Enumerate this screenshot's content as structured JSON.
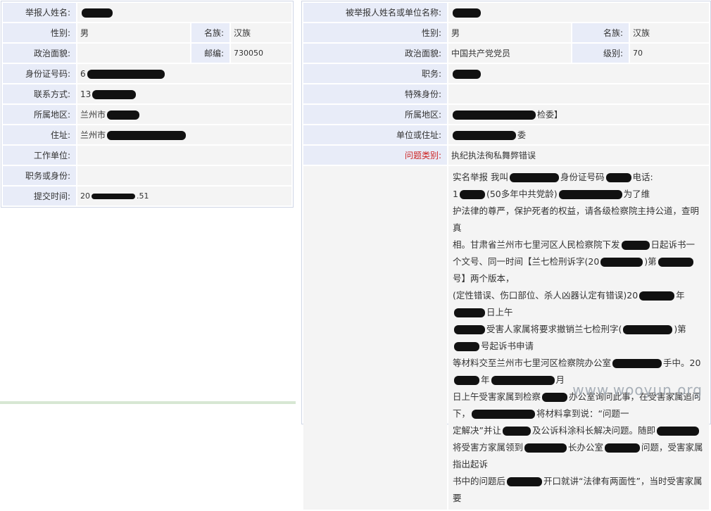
{
  "reporter": {
    "name_label": "举报人姓名:",
    "gender_label": "性别:",
    "gender": "男",
    "ethnicity_label": "名族:",
    "ethnicity": "汉族",
    "political_label": "政治面貌:",
    "postcode_label": "邮编:",
    "postcode": "730050",
    "idcard_label": "身份证号码:",
    "idcard_prefix": "6",
    "contact_label": "联系方式:",
    "contact_prefix": "13",
    "region_label": "所属地区:",
    "region_prefix": "兰州市",
    "address_label": "住址:",
    "address_prefix": "兰州市",
    "workunit_label": "工作单位:",
    "position_label": "职务或身份:",
    "submit_label": "提交时间:",
    "submit_prefix": "20",
    "submit_suffix": ".51"
  },
  "accused": {
    "name_label": "被举报人姓名或单位名称:",
    "gender_label": "性别:",
    "gender": "男",
    "ethnicity_label": "名族:",
    "ethnicity": "汉族",
    "political_label": "政治面貌:",
    "political": "中国共产党党员",
    "level_label": "级别:",
    "level": "70",
    "duty_label": "职务:",
    "special_label": "特殊身份:",
    "region_label": "所属地区:",
    "region_suffix": "检委】",
    "unit_label": "单位或住址:",
    "unit_suffix": "委",
    "category_label": "问题类别:",
    "category": "执纪执法徇私舞弊错误",
    "content_lines": [
      [
        "实名举报 我叫",
        "身份证号码",
        "电话:"
      ],
      [
        "1",
        "(50多年中共党龄)",
        "为了维"
      ],
      [
        "护法律的尊严，保护死者的权益，请各级检察院主持公道，查明真"
      ],
      [
        "相。甘肃省兰州市七里河区人民检察院下发",
        "日起诉书一"
      ],
      [
        "个文号、同一时间【兰七检刑诉字(20",
        ")第",
        "号】两个版本，"
      ],
      [
        "(定性错误、伤口部位、杀人凶器认定有错误)20",
        "年",
        "日上午"
      ],
      [
        "",
        "受害人家属将要求撤销兰七检刑字(",
        ")第",
        "号起诉书申请"
      ],
      [
        "等材料交至兰州市七里河区检察院办公室",
        "手中。20",
        "年",
        "月"
      ],
      [
        "日上午受害家属到检察",
        "办公室询问此事，在受害家属追问"
      ],
      [
        "下，",
        "将材料拿到说：“问题一"
      ],
      [
        "定解决”并让",
        "及公诉科涂科长解决问题。随即",
        ""
      ],
      [
        "将受害方家属领到",
        "长办公室",
        "问题，受害家属指出起诉"
      ],
      [
        "书中的问题后",
        "开口就讲“法律有两面性”，当时受害家属要"
      ]
    ]
  },
  "watermark": "www.wooyun.org"
}
